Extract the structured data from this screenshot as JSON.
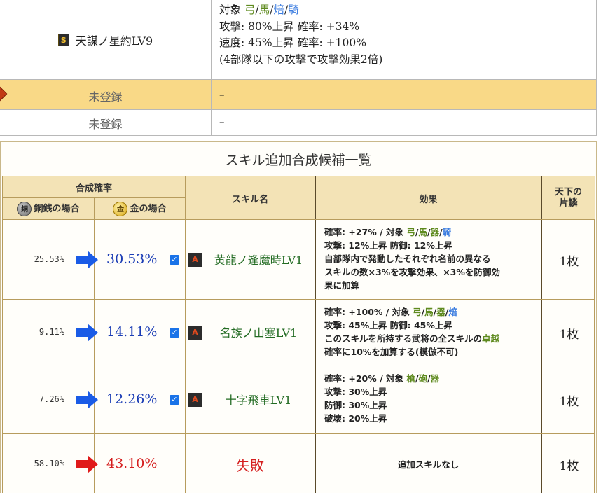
{
  "top": {
    "skill_badge": "S",
    "skill_name": "天謀ノ星約LV9",
    "effect_lines": [
      {
        "pre": "対象 ",
        "parts": [
          [
            "弓",
            "green"
          ],
          [
            "/",
            ""
          ],
          [
            "馬",
            "green"
          ],
          [
            "/",
            ""
          ],
          [
            "焙",
            "blue"
          ],
          [
            "/",
            ""
          ],
          [
            "騎",
            "blue"
          ]
        ]
      },
      {
        "text": "攻撃: 80%上昇 確率: +34%"
      },
      {
        "text": "速度: 45%上昇 確率: +100%"
      },
      {
        "text": "(4部隊以下の攻撃で攻撃効果2倍)"
      }
    ],
    "rows": [
      {
        "label": "未登録",
        "value": "–"
      },
      {
        "label": "未登録",
        "value": "–"
      }
    ]
  },
  "panel": {
    "title": "スキル追加合成候補一覧",
    "headers": {
      "rate_group": "合成確率",
      "copper": "銅銭の場合",
      "gold": "金の場合",
      "skill": "スキル名",
      "effect": "効果",
      "cost": "天下の\n片鱗",
      "copper_coin": "銅",
      "gold_coin": "金"
    },
    "rows": [
      {
        "copper_rate": "25.53%",
        "gold_rate": "30.53%",
        "arrow_color": "#1a5be6",
        "checked": true,
        "badge": "A",
        "skill": "黄龍ノ逢魔時LV1",
        "effect_lines": [
          [
            [
              "確率: +27% / 対象 ",
              ""
            ],
            [
              "弓",
              "green"
            ],
            [
              "/",
              ""
            ],
            [
              "馬",
              "green"
            ],
            [
              "/",
              ""
            ],
            [
              "器",
              "green"
            ],
            [
              "/",
              ""
            ],
            [
              "騎",
              "blue"
            ]
          ],
          [
            [
              "攻撃: 12%上昇 防御: 12%上昇",
              ""
            ]
          ],
          [
            [
              "自部隊内で発動したそれぞれ名前の異なる",
              ""
            ]
          ],
          [
            [
              "スキルの数×3%を攻撃効果、×3%を防御効",
              ""
            ]
          ],
          [
            [
              "果に加算",
              ""
            ]
          ]
        ],
        "cost": "1枚"
      },
      {
        "copper_rate": "9.11%",
        "gold_rate": "14.11%",
        "arrow_color": "#1a5be6",
        "checked": true,
        "badge": "A",
        "skill": "名族ノ山塞LV1",
        "effect_lines": [
          [
            [
              "確率: +100% / 対象 ",
              ""
            ],
            [
              "弓",
              "green"
            ],
            [
              "/",
              ""
            ],
            [
              "馬",
              "green"
            ],
            [
              "/",
              ""
            ],
            [
              "器",
              "green"
            ],
            [
              "/",
              ""
            ],
            [
              "焙",
              "blue"
            ]
          ],
          [
            [
              "攻撃: 45%上昇 防御: 45%上昇",
              ""
            ]
          ],
          [
            [
              "このスキルを所持する武将の全スキルの",
              ""
            ],
            [
              "卓越",
              "green"
            ]
          ],
          [
            [
              "確率に10%を加算する(模倣不可)",
              ""
            ]
          ]
        ],
        "cost": "1枚"
      },
      {
        "copper_rate": "7.26%",
        "gold_rate": "12.26%",
        "arrow_color": "#1a5be6",
        "checked": true,
        "badge": "A",
        "skill": "十字飛車LV1",
        "effect_lines": [
          [
            [
              "確率: +20% / 対象 ",
              ""
            ],
            [
              "槍",
              "green"
            ],
            [
              "/",
              ""
            ],
            [
              "砲",
              "green"
            ],
            [
              "/",
              ""
            ],
            [
              "器",
              "green"
            ]
          ],
          [
            [
              "攻撃: 30%上昇",
              ""
            ]
          ],
          [
            [
              "防御: 30%上昇",
              ""
            ]
          ],
          [
            [
              "破壊: 20%上昇",
              ""
            ]
          ]
        ],
        "cost": "1枚"
      },
      {
        "copper_rate": "58.10%",
        "gold_rate": "43.10%",
        "arrow_color": "#e01a1a",
        "checked": false,
        "badge": "",
        "skill": "失敗",
        "effect_lines": [
          [
            [
              "追加スキルなし",
              ""
            ]
          ]
        ],
        "cost": "1枚"
      }
    ]
  }
}
